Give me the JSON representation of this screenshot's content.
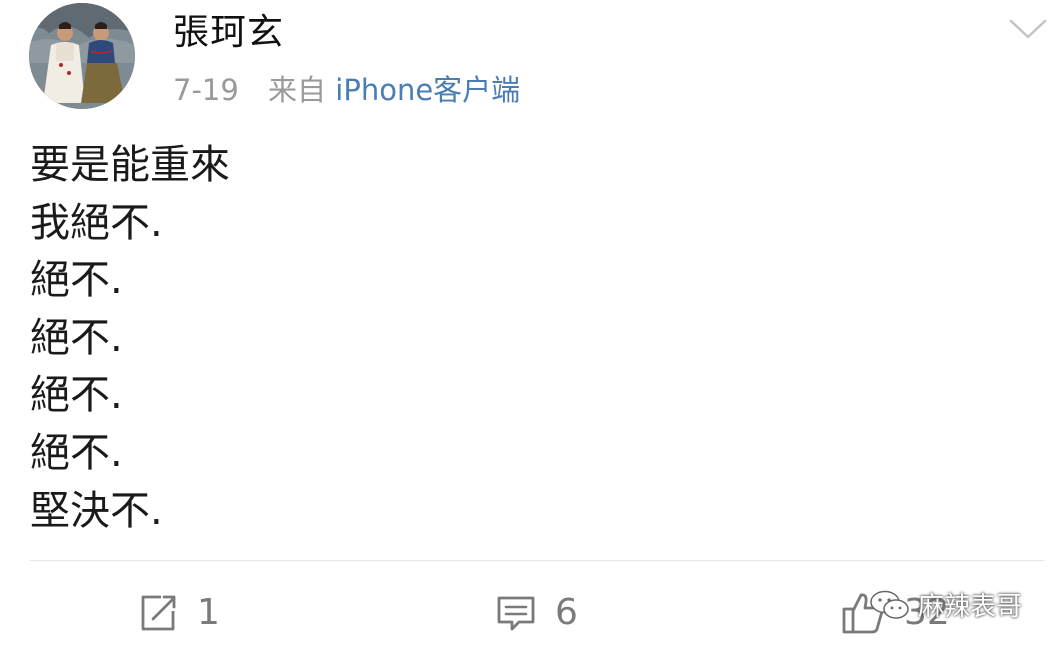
{
  "header": {
    "username": "張珂玄",
    "date": "7-19",
    "source_prefix": "来自",
    "source_link": "iPhone客户端"
  },
  "post": {
    "lines": [
      "要是能重來",
      "我絕不.",
      "絕不.",
      "絕不.",
      "絕不.",
      "絕不.",
      "堅決不."
    ]
  },
  "actions": {
    "repost_count": "1",
    "comment_count": "6",
    "like_count": "32"
  },
  "watermark": {
    "text": "麻辣表哥"
  },
  "icons": {
    "avatar": "avatar-painting",
    "chevron": "chevron-down-icon",
    "repost": "repost-icon",
    "comment": "comment-icon",
    "like": "thumbs-up-icon",
    "watermark": "wechat-icon"
  },
  "colors": {
    "link": "#4b7db5",
    "meta": "#9a9a9a",
    "icon": "#7a7a7a"
  }
}
